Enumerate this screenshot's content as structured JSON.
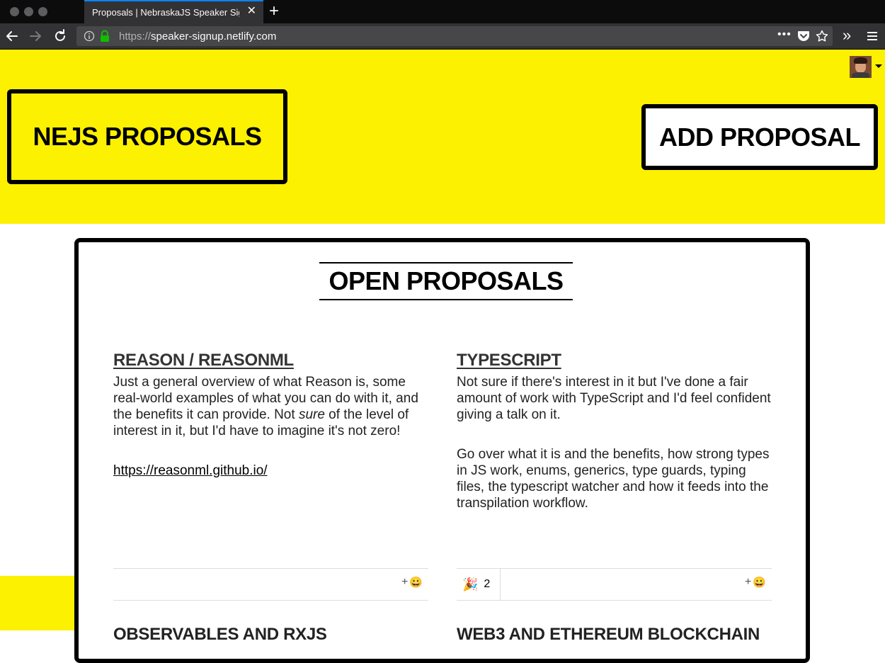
{
  "browser": {
    "tab_title": "Proposals | NebraskaJS Speaker Signup",
    "url_scheme": "https://",
    "url_host": "speaker-signup.netlify.com"
  },
  "header": {
    "brand": "NEJS PROPOSALS",
    "add_button": "ADD PROPOSAL"
  },
  "panel": {
    "title": "OPEN PROPOSALS"
  },
  "proposals": [
    {
      "title": "REASON / REASONML",
      "body_p1_a": "Just a general overview of what Reason is, some real-world examples of what you can do with it, and the benefits it can provide. Not ",
      "body_p1_em": "sure",
      "body_p1_b": " of the level of interest in it, but I'd have to imagine it's not zero!",
      "link": "https://reasonml.github.io/"
    },
    {
      "title": "TYPESCRIPT",
      "body_p1": "Not sure if there's interest in it but I've done a fair amount of work with TypeScript and I'd feel confident giving a talk on it.",
      "body_p2": "Go over what it is and the benefits, how strong types in JS work, enums, generics, type guards, typing files, the typescript watcher and how it feeds into the transpilation workflow.",
      "reaction_emoji": "🎉",
      "reaction_count": "2"
    }
  ],
  "next_titles": [
    "OBSERVABLES AND RXJS",
    "WEB3 AND ETHEREUM BLOCKCHAIN"
  ],
  "reaction_add_plus": "+",
  "reaction_add_icon": "😀",
  "colors": {
    "brand_yellow": "#fbf100",
    "chrome_dark": "#0c0c0d",
    "chrome_mid": "#323234",
    "accent_blue": "#0a84ff"
  }
}
